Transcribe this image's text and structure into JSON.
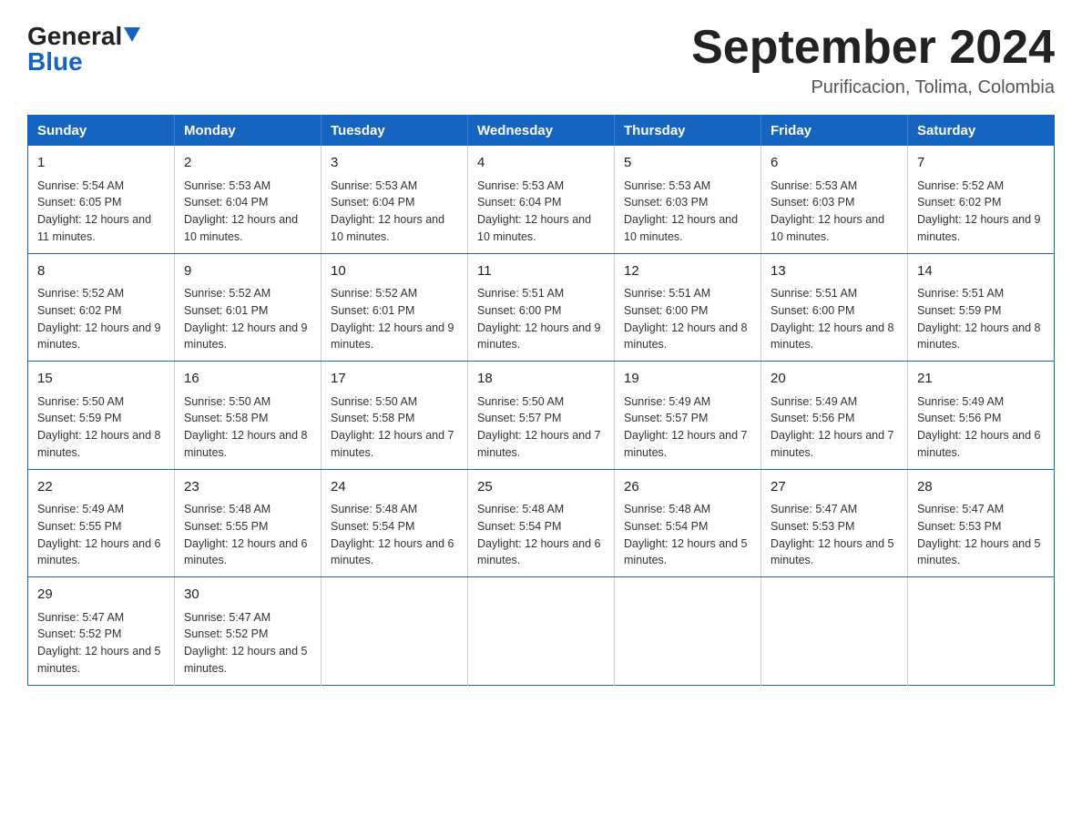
{
  "header": {
    "logo_general": "General",
    "logo_blue": "Blue",
    "month_title": "September 2024",
    "location": "Purificacion, Tolima, Colombia"
  },
  "weekdays": [
    "Sunday",
    "Monday",
    "Tuesday",
    "Wednesday",
    "Thursday",
    "Friday",
    "Saturday"
  ],
  "weeks": [
    [
      {
        "day": "1",
        "sunrise": "5:54 AM",
        "sunset": "6:05 PM",
        "daylight": "12 hours and 11 minutes."
      },
      {
        "day": "2",
        "sunrise": "5:53 AM",
        "sunset": "6:04 PM",
        "daylight": "12 hours and 10 minutes."
      },
      {
        "day": "3",
        "sunrise": "5:53 AM",
        "sunset": "6:04 PM",
        "daylight": "12 hours and 10 minutes."
      },
      {
        "day": "4",
        "sunrise": "5:53 AM",
        "sunset": "6:04 PM",
        "daylight": "12 hours and 10 minutes."
      },
      {
        "day": "5",
        "sunrise": "5:53 AM",
        "sunset": "6:03 PM",
        "daylight": "12 hours and 10 minutes."
      },
      {
        "day": "6",
        "sunrise": "5:53 AM",
        "sunset": "6:03 PM",
        "daylight": "12 hours and 10 minutes."
      },
      {
        "day": "7",
        "sunrise": "5:52 AM",
        "sunset": "6:02 PM",
        "daylight": "12 hours and 9 minutes."
      }
    ],
    [
      {
        "day": "8",
        "sunrise": "5:52 AM",
        "sunset": "6:02 PM",
        "daylight": "12 hours and 9 minutes."
      },
      {
        "day": "9",
        "sunrise": "5:52 AM",
        "sunset": "6:01 PM",
        "daylight": "12 hours and 9 minutes."
      },
      {
        "day": "10",
        "sunrise": "5:52 AM",
        "sunset": "6:01 PM",
        "daylight": "12 hours and 9 minutes."
      },
      {
        "day": "11",
        "sunrise": "5:51 AM",
        "sunset": "6:00 PM",
        "daylight": "12 hours and 9 minutes."
      },
      {
        "day": "12",
        "sunrise": "5:51 AM",
        "sunset": "6:00 PM",
        "daylight": "12 hours and 8 minutes."
      },
      {
        "day": "13",
        "sunrise": "5:51 AM",
        "sunset": "6:00 PM",
        "daylight": "12 hours and 8 minutes."
      },
      {
        "day": "14",
        "sunrise": "5:51 AM",
        "sunset": "5:59 PM",
        "daylight": "12 hours and 8 minutes."
      }
    ],
    [
      {
        "day": "15",
        "sunrise": "5:50 AM",
        "sunset": "5:59 PM",
        "daylight": "12 hours and 8 minutes."
      },
      {
        "day": "16",
        "sunrise": "5:50 AM",
        "sunset": "5:58 PM",
        "daylight": "12 hours and 8 minutes."
      },
      {
        "day": "17",
        "sunrise": "5:50 AM",
        "sunset": "5:58 PM",
        "daylight": "12 hours and 7 minutes."
      },
      {
        "day": "18",
        "sunrise": "5:50 AM",
        "sunset": "5:57 PM",
        "daylight": "12 hours and 7 minutes."
      },
      {
        "day": "19",
        "sunrise": "5:49 AM",
        "sunset": "5:57 PM",
        "daylight": "12 hours and 7 minutes."
      },
      {
        "day": "20",
        "sunrise": "5:49 AM",
        "sunset": "5:56 PM",
        "daylight": "12 hours and 7 minutes."
      },
      {
        "day": "21",
        "sunrise": "5:49 AM",
        "sunset": "5:56 PM",
        "daylight": "12 hours and 6 minutes."
      }
    ],
    [
      {
        "day": "22",
        "sunrise": "5:49 AM",
        "sunset": "5:55 PM",
        "daylight": "12 hours and 6 minutes."
      },
      {
        "day": "23",
        "sunrise": "5:48 AM",
        "sunset": "5:55 PM",
        "daylight": "12 hours and 6 minutes."
      },
      {
        "day": "24",
        "sunrise": "5:48 AM",
        "sunset": "5:54 PM",
        "daylight": "12 hours and 6 minutes."
      },
      {
        "day": "25",
        "sunrise": "5:48 AM",
        "sunset": "5:54 PM",
        "daylight": "12 hours and 6 minutes."
      },
      {
        "day": "26",
        "sunrise": "5:48 AM",
        "sunset": "5:54 PM",
        "daylight": "12 hours and 5 minutes."
      },
      {
        "day": "27",
        "sunrise": "5:47 AM",
        "sunset": "5:53 PM",
        "daylight": "12 hours and 5 minutes."
      },
      {
        "day": "28",
        "sunrise": "5:47 AM",
        "sunset": "5:53 PM",
        "daylight": "12 hours and 5 minutes."
      }
    ],
    [
      {
        "day": "29",
        "sunrise": "5:47 AM",
        "sunset": "5:52 PM",
        "daylight": "12 hours and 5 minutes."
      },
      {
        "day": "30",
        "sunrise": "5:47 AM",
        "sunset": "5:52 PM",
        "daylight": "12 hours and 5 minutes."
      },
      null,
      null,
      null,
      null,
      null
    ]
  ]
}
